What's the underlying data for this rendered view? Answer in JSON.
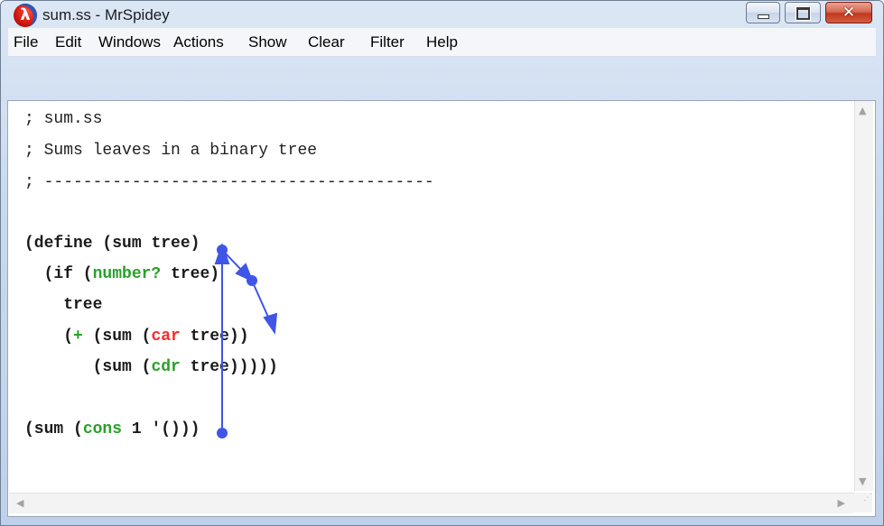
{
  "window": {
    "title": "sum.ss - MrSpidey",
    "app_icon": "racket-lambda-icon",
    "controls": {
      "minimize": "minimize-icon",
      "maximize": "maximize-icon",
      "close_glyph": "✕"
    }
  },
  "menu": [
    "File",
    "Edit",
    "Windows",
    "Actions",
    "Show",
    "Clear",
    "Filter",
    "Help"
  ],
  "editor": {
    "lines": {
      "c1": "; sum.ss",
      "c2": "; Sums leaves in a binary tree",
      "c3": "; ----------------------------------------",
      "l1_a": "(define (sum ",
      "l1_b": "tree",
      "l1_c": ")",
      "l2_a": "  (if (",
      "l2_prim": "number?",
      "l2_b": " ",
      "l2_c": "tree",
      "l2_d": ")",
      "l3": "    tree",
      "l4_a": "    (",
      "l4_plus": "+",
      "l4_b": " (sum (",
      "l4_car": "car",
      "l4_c": " ",
      "l4_d": "tree",
      "l4_e": "))",
      "l5_a": "       (sum (",
      "l5_cdr": "cdr",
      "l5_b": " tree)))))",
      "l6_a": "(sum (",
      "l6_cons": "cons",
      "l6_b": " 1 ",
      "l6_c": "'",
      "l6_d": "()))"
    }
  },
  "colors": {
    "arrow": "#3f55e8",
    "primitive": "#2aa02a",
    "selected_prim": "#ff2a2a"
  }
}
